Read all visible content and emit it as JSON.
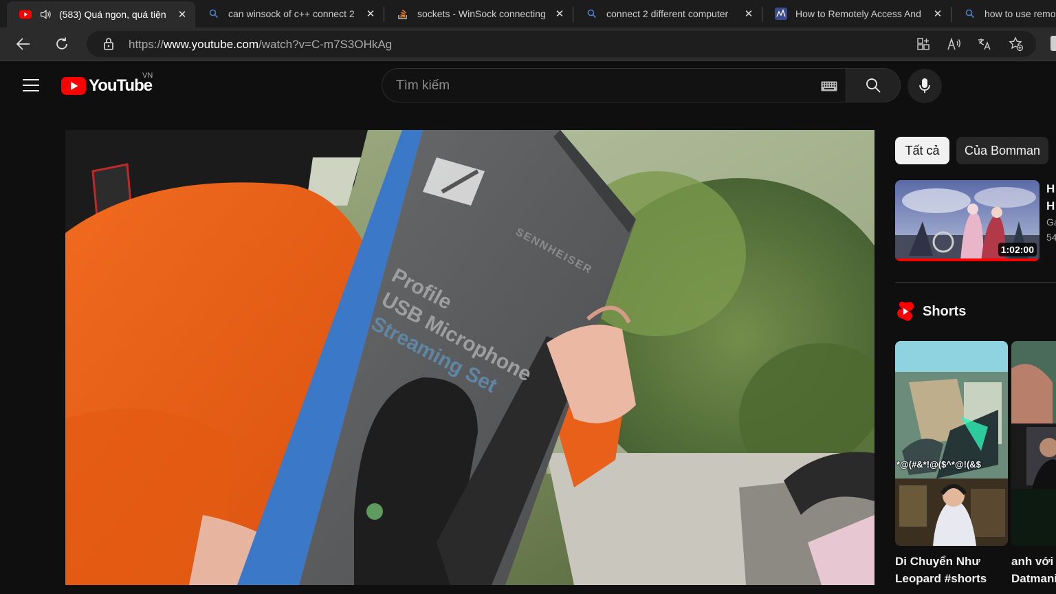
{
  "browser": {
    "tabs": [
      {
        "title": "(583) Quá ngon, quá tiện",
        "icon": "youtube-icon",
        "active": true
      },
      {
        "title": "can winsock of c++ connect 2",
        "icon": "search-icon",
        "active": false
      },
      {
        "title": "sockets - WinSock connecting",
        "icon": "stackoverflow-icon",
        "active": false
      },
      {
        "title": "connect 2 different computer",
        "icon": "search-icon",
        "active": false
      },
      {
        "title": "How to Remotely Access And",
        "icon": "site-icon",
        "active": false
      },
      {
        "title": "how to use remo",
        "icon": "search-icon",
        "active": false
      }
    ],
    "url_prefix": "https://",
    "url_host": "www.youtube.com",
    "url_path": "/watch?v=C-m7S3OHkAg"
  },
  "masthead": {
    "logo_text": "YouTube",
    "region": "VN",
    "search_placeholder": "Tìm kiếm"
  },
  "sidebar": {
    "chips": [
      "Tất cả",
      "Của Bomman"
    ],
    "recommended": {
      "duration": "1:02:00",
      "watched_fraction": 1.0,
      "title_lines": [
        "H",
        "H"
      ],
      "meta_lines": [
        "Ga",
        "54"
      ]
    },
    "shorts_label": "Shorts",
    "shorts": [
      {
        "title": "Di Chuyển Như\nLeopard #shorts",
        "overlay_text": "*@(#&*!@($^*@!(&$"
      },
      {
        "title": "anh với\nDatmani"
      }
    ]
  },
  "player": {
    "box_text_1": "Profile",
    "box_text_2": "USB Microphone",
    "box_text_3": "Streaming Set",
    "box_brand": "SENNHEISER"
  },
  "colors": {
    "yt_red": "#ff0000",
    "bg": "#0f0f0f",
    "chip_active": "#f1f1f1",
    "chip_inactive": "#272727"
  }
}
